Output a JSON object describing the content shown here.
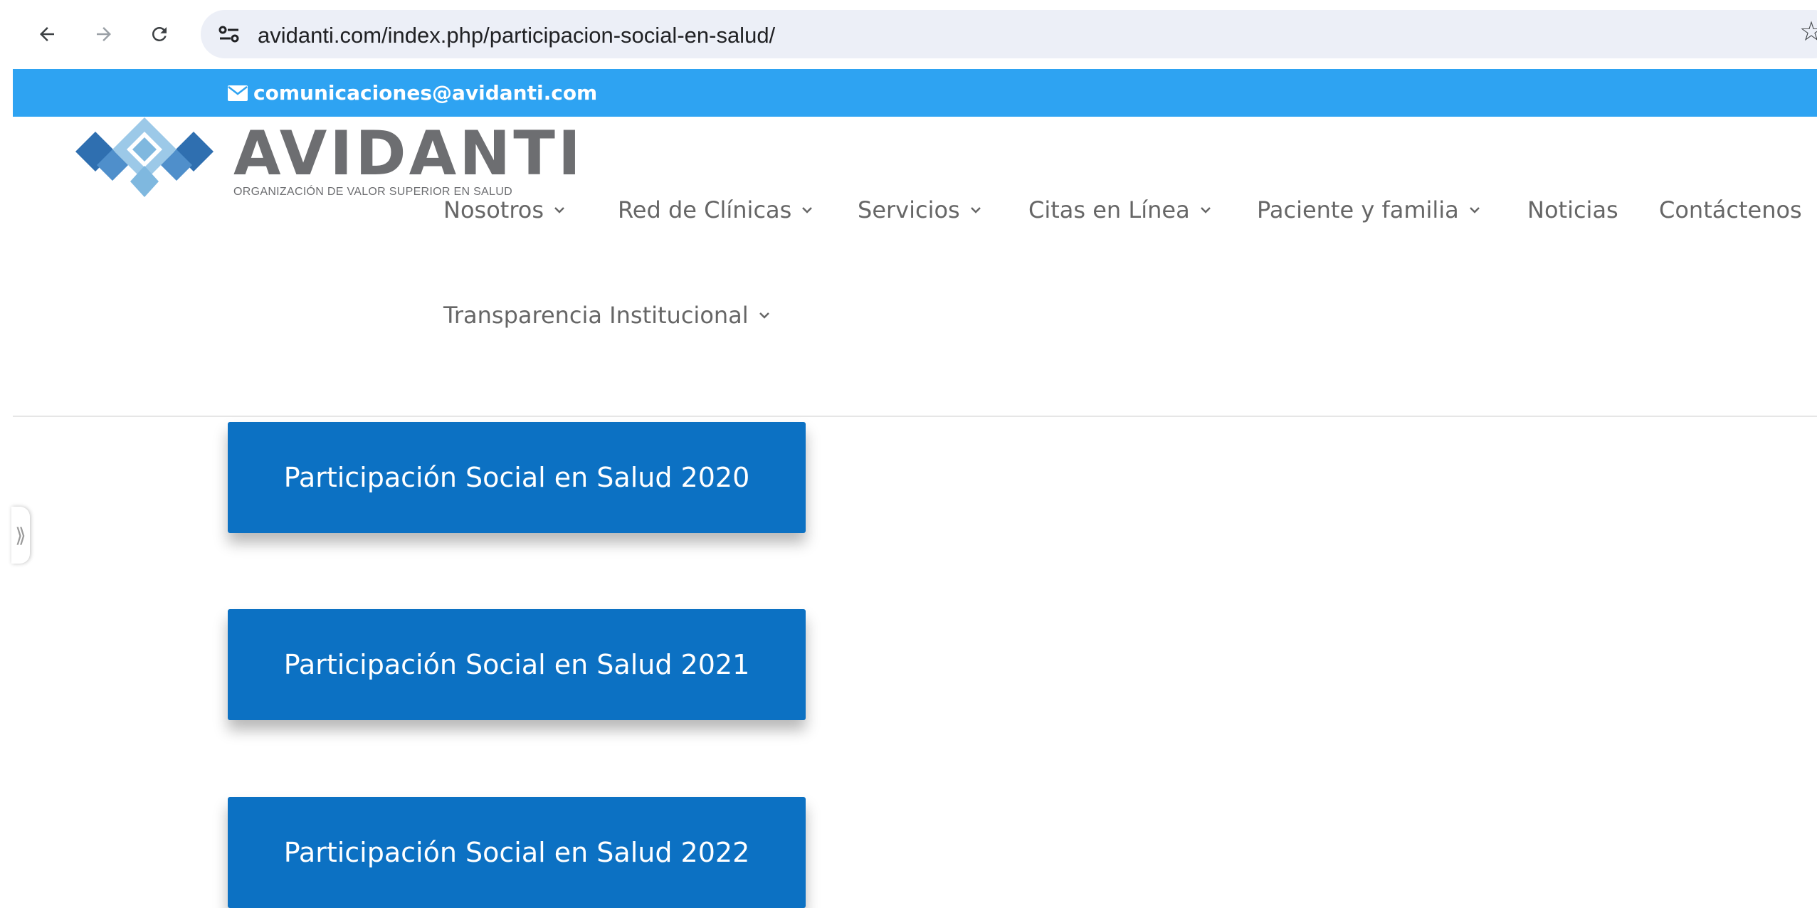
{
  "browser": {
    "url": "avidanti.com/index.php/participacion-social-en-salud/",
    "back_icon": "arrow-left-icon",
    "forward_icon": "arrow-right-icon",
    "reload_icon": "reload-icon",
    "site_info_icon": "tune-icon",
    "bookmark_icon": "star-icon"
  },
  "topbar": {
    "email": "comunicaciones@avidanti.com",
    "background": "#2ea3f2"
  },
  "logo": {
    "wordmark": "AVIDANTI",
    "tagline": "ORGANIZACIÓN DE VALOR SUPERIOR EN SALUD"
  },
  "menu": [
    {
      "label": "Nosotros",
      "has_dropdown": true
    },
    {
      "label": "Red de Clínicas",
      "has_dropdown": true
    },
    {
      "label": "Servicios",
      "has_dropdown": true
    },
    {
      "label": "Citas en Línea",
      "has_dropdown": true
    },
    {
      "label": "Paciente y familia",
      "has_dropdown": true
    },
    {
      "label": "Noticias",
      "has_dropdown": false
    },
    {
      "label": "Contáctenos",
      "has_dropdown": false
    },
    {
      "label": "Transparencia Institucional",
      "has_dropdown": true
    }
  ],
  "content": {
    "buttons": [
      {
        "label": "Participación Social en Salud 2020"
      },
      {
        "label": "Participación Social en Salud 2021"
      },
      {
        "label": "Participación Social en Salud 2022"
      }
    ],
    "button_color": "#0c71c3",
    "side_tab_icon": "double-chevron-right-icon"
  }
}
